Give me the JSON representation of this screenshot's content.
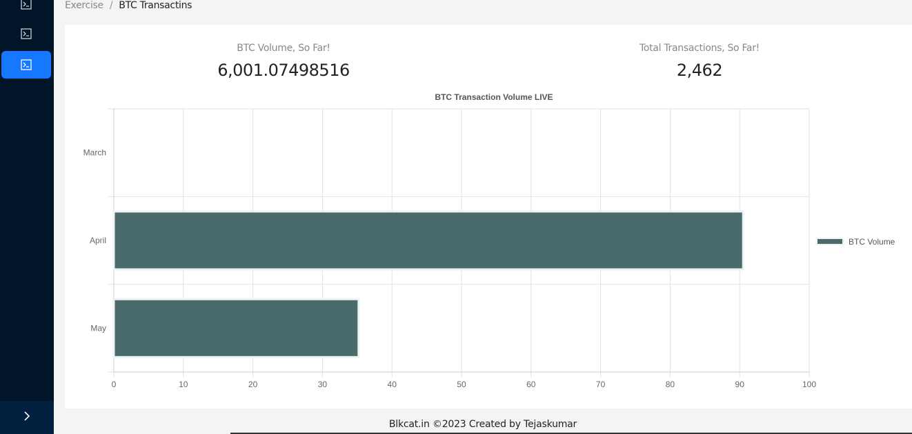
{
  "sidebar": {
    "items": [
      {
        "icon": "terminal-icon",
        "active": false
      },
      {
        "icon": "terminal-icon",
        "active": false
      },
      {
        "icon": "terminal-icon",
        "active": true
      }
    ],
    "collapse_icon": "chevron-right-icon"
  },
  "breadcrumb": {
    "parent": "Exercise",
    "separator": "/",
    "current": "BTC Transactins"
  },
  "stats": {
    "volume": {
      "title": "BTC Volume, So Far!",
      "value": "6,001.07498516"
    },
    "transactions": {
      "title": "Total Transactions, So Far!",
      "value": "2,462"
    }
  },
  "chart_data": {
    "type": "bar",
    "orientation": "horizontal",
    "title": "BTC Transaction Volume LIVE",
    "categories": [
      "March",
      "April",
      "May"
    ],
    "series": [
      {
        "name": "BTC Volume",
        "values": [
          0,
          90.5,
          35.2
        ],
        "color": "#4a6b6b"
      }
    ],
    "xlim": [
      0,
      100
    ],
    "xticks": [
      0,
      10,
      20,
      30,
      40,
      50,
      60,
      70,
      80,
      90,
      100
    ],
    "grid": true,
    "legend": "right"
  },
  "footer": {
    "text": "Blkcat.in ©2023 Created by Tejaskumar"
  }
}
